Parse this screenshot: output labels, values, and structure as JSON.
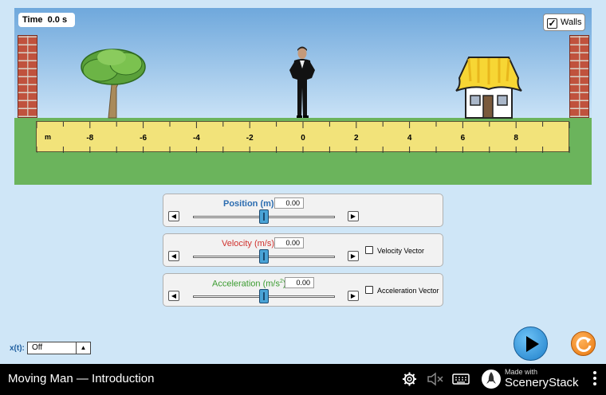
{
  "scene": {
    "time_label": "Time",
    "time_value": "0.0 s",
    "walls_label": "Walls",
    "walls_checked": true,
    "ruler": {
      "unit": "m",
      "tick_labels": [
        "-8",
        "-6",
        "-4",
        "-2",
        "0",
        "2",
        "4",
        "6",
        "8"
      ]
    }
  },
  "controls": {
    "position": {
      "label": "Position (m)",
      "value": "0.00",
      "color": "#2b6cb0"
    },
    "velocity": {
      "label": "Velocity (m/s)",
      "value": "0.00",
      "color": "#d0312d",
      "vector_label": "Velocity Vector"
    },
    "acceleration": {
      "label_prefix": "Acceleration (m/s",
      "label_sup": "2",
      "label_suffix": ")",
      "value": "0.00",
      "color": "#3a9b2f",
      "vector_label": "Acceleration Vector"
    }
  },
  "xt": {
    "label": "x(t):",
    "selected": "Off"
  },
  "navbar": {
    "title": "Moving Man — Introduction",
    "brand_small": "Made with",
    "brand_big": "SceneryStack"
  }
}
